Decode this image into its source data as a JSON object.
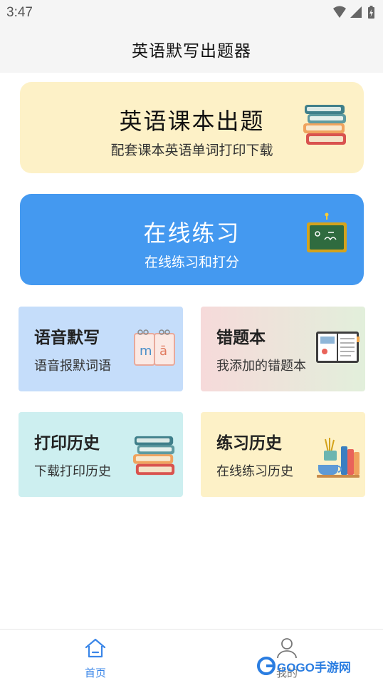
{
  "status_bar": {
    "time": "3:47",
    "icons": [
      "wifi-icon",
      "signal-icon",
      "battery-icon"
    ]
  },
  "header": {
    "title": "英语默写出题器"
  },
  "main": {
    "big_cards": [
      {
        "title": "英语课本出题",
        "subtitle": "配套课本英语单词打印下载",
        "icon": "books-stack-icon",
        "bg": "#fdf1c7"
      },
      {
        "title": "在线练习",
        "subtitle": "在线练习和打分",
        "icon": "chalkboard-icon",
        "bg": "#4499f0"
      }
    ],
    "small_cards": [
      {
        "title": "语音默写",
        "subtitle": "语音报默词语",
        "icon": "pinyin-flipbook-icon",
        "bg": "#c5ddfa"
      },
      {
        "title": "错题本",
        "subtitle": "我添加的错题本",
        "icon": "open-notebook-icon",
        "bg": "#f6dada"
      },
      {
        "title": "打印历史",
        "subtitle": "下载打印历史",
        "icon": "books-stack-icon",
        "bg": "#cdeff0"
      },
      {
        "title": "练习历史",
        "subtitle": "在线练习历史",
        "icon": "study-desk-icon",
        "bg": "#fdf1c7"
      }
    ]
  },
  "bottom_nav": {
    "items": [
      {
        "label": "首页",
        "icon": "home-icon",
        "active": true
      },
      {
        "label": "我的",
        "icon": "user-icon",
        "active": false
      }
    ],
    "accent": "#3a86e8"
  },
  "watermark": {
    "text": "GOGO手游网"
  }
}
